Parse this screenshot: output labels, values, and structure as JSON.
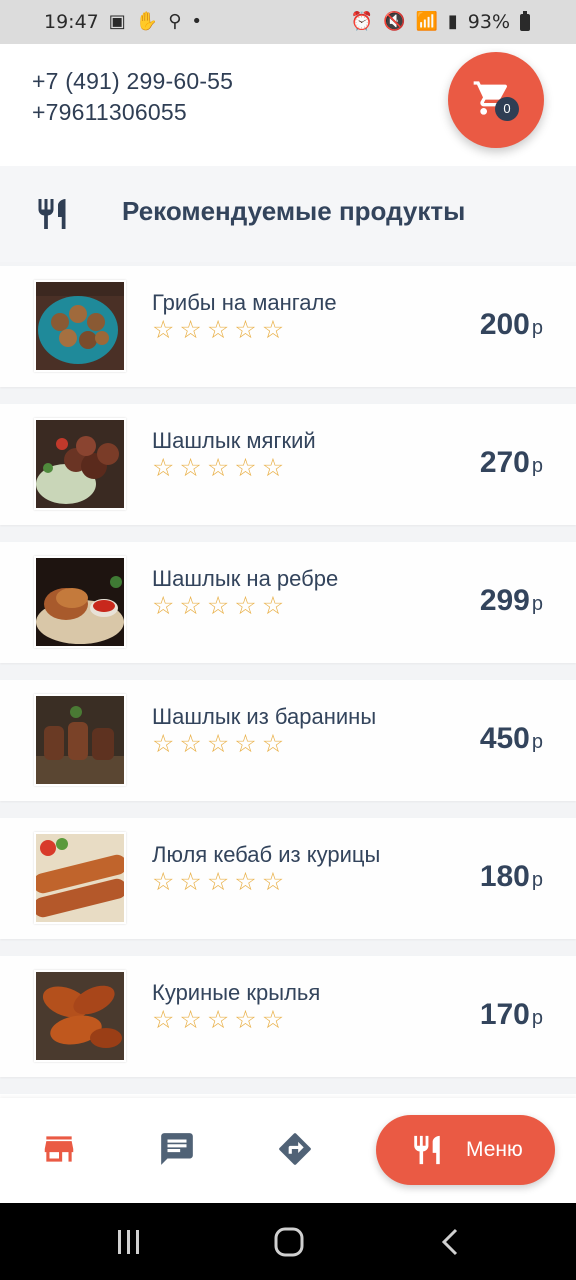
{
  "status_bar": {
    "time": "19:47",
    "battery": "93%",
    "icons_left": [
      "gallery-icon",
      "hand-icon",
      "search-icon",
      "dot-icon"
    ],
    "icons_right": [
      "alarm-icon",
      "mute-icon",
      "wifi-icon",
      "signal-icon",
      "signal-icon",
      "battery-icon"
    ]
  },
  "header": {
    "phones": [
      "+7 (491) 299-60-55",
      "+79611306055"
    ],
    "cart": {
      "icon": "cart-icon",
      "count": "0"
    }
  },
  "section": {
    "icon": "fork-knife-icon",
    "title": "Рекомендуемые продукты"
  },
  "products": [
    {
      "name": "Грибы на мангале",
      "price": "200",
      "currency": "р",
      "rating": 0,
      "image": "grilled-mushrooms"
    },
    {
      "name": "Шашлык мягкий",
      "price": "270",
      "currency": "р",
      "rating": 0,
      "image": "soft-shashlik"
    },
    {
      "name": "Шашлык на ребре",
      "price": "299",
      "currency": "р",
      "rating": 0,
      "image": "rib-shashlik"
    },
    {
      "name": "Шашлык из баранины",
      "price": "450",
      "currency": "р",
      "rating": 0,
      "image": "lamb-shashlik"
    },
    {
      "name": "Люля кебаб из курицы",
      "price": "180",
      "currency": "р",
      "rating": 0,
      "image": "chicken-lula-kebab"
    },
    {
      "name": "Куриные крылья",
      "price": "170",
      "currency": "р",
      "rating": 0,
      "image": "chicken-wings"
    }
  ],
  "bottom_nav": {
    "items": [
      {
        "icon": "store-icon",
        "active": true
      },
      {
        "icon": "chat-icon",
        "active": false
      },
      {
        "icon": "directions-icon",
        "active": false
      }
    ],
    "menu_button": {
      "icon": "fork-knife-icon",
      "label": "Меню"
    }
  },
  "system_nav": [
    "recent-apps-icon",
    "home-icon",
    "back-icon"
  ],
  "colors": {
    "accent": "#ea5a44",
    "text": "#33445c",
    "star": "#e9b14a",
    "background": "#f3f4f6"
  }
}
